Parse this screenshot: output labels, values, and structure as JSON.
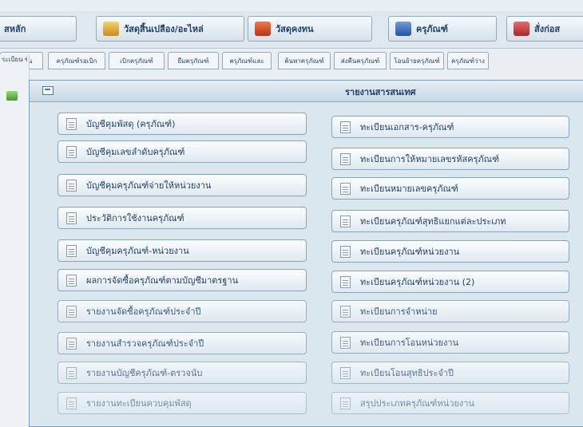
{
  "topbar": {
    "items": [
      {
        "label": "สหลัก",
        "icon": "none"
      },
      {
        "label": "วัสดุสิ้นเปลือง/อะไหล่",
        "icon": "box-icon"
      },
      {
        "label": "วัสดุคงทน",
        "icon": "tool-icon"
      },
      {
        "label": "ครุภัณฑ์",
        "icon": "truck-icon"
      },
      {
        "label": "สั่งก่อส",
        "icon": "books-icon"
      }
    ]
  },
  "tabs": [
    "ระเบียน",
    "ครุภัณฑ์รอเบิก",
    "เบิกครุภัณฑ์",
    "ยืมครุภัณฑ์",
    "ครุภัณฑ์และ",
    "ค้นหาครุภัณฑ์",
    "ส่งคืนครุภัณฑ์",
    "โอนย้ายครุภัณฑ์",
    "ครุภัณฑ์ว่าง"
  ],
  "sidebar": {
    "label": "ระเบียน ข้อ"
  },
  "report_window": {
    "title": "รายงานสารสนเทศ",
    "left_buttons": [
      "บัญชีคุมพัสดุ (ครุภัณฑ์)",
      "บัญชีคุมเลขลำดับครุภัณฑ์",
      "บัญชีคุมครุภัณฑ์จ่ายให้หน่วยงาน",
      "ประวัติการใช้งานครุภัณฑ์",
      "บัญชีคุมครุภัณฑ์-หน่วยงาน",
      "ผลการจัดซื้อครุภัณฑ์ตามบัญชีมาตรฐาน",
      "รายงานจัดซื้อครุภัณฑ์ประจำปี",
      "รายงานสำรวจครุภัณฑ์ประจำปี",
      "รายงานบัญชีครุภัณฑ์-ตรวจนับ",
      "รายงานทะเบียนควบคุมพัสดุ"
    ],
    "right_buttons": [
      "ทะเบียนเอกสาร-ครุภัณฑ์",
      "ทะเบียนการให้หมายเลขรหัสครุภัณฑ์",
      "ทะเบียนหมายเลขครุภัณฑ์",
      "ทะเบียนครุภัณฑ์สุทธิแยกแต่ละประเภท",
      "ทะเบียนครุภัณฑ์หน่วยงาน",
      "ทะเบียนครุภัณฑ์หน่วยงาน (2)",
      "ทะเบียนการจำหน่าย",
      "ทะเบียนการโอนหน่วยงาน",
      "ทะเบียนโอนสุทธิประจำปี",
      "สรุปประเภทครุภัณฑ์หน่วยงาน"
    ]
  },
  "colors": {
    "accent": "#1f3f6c",
    "window_bg": "#dbe7ef"
  }
}
